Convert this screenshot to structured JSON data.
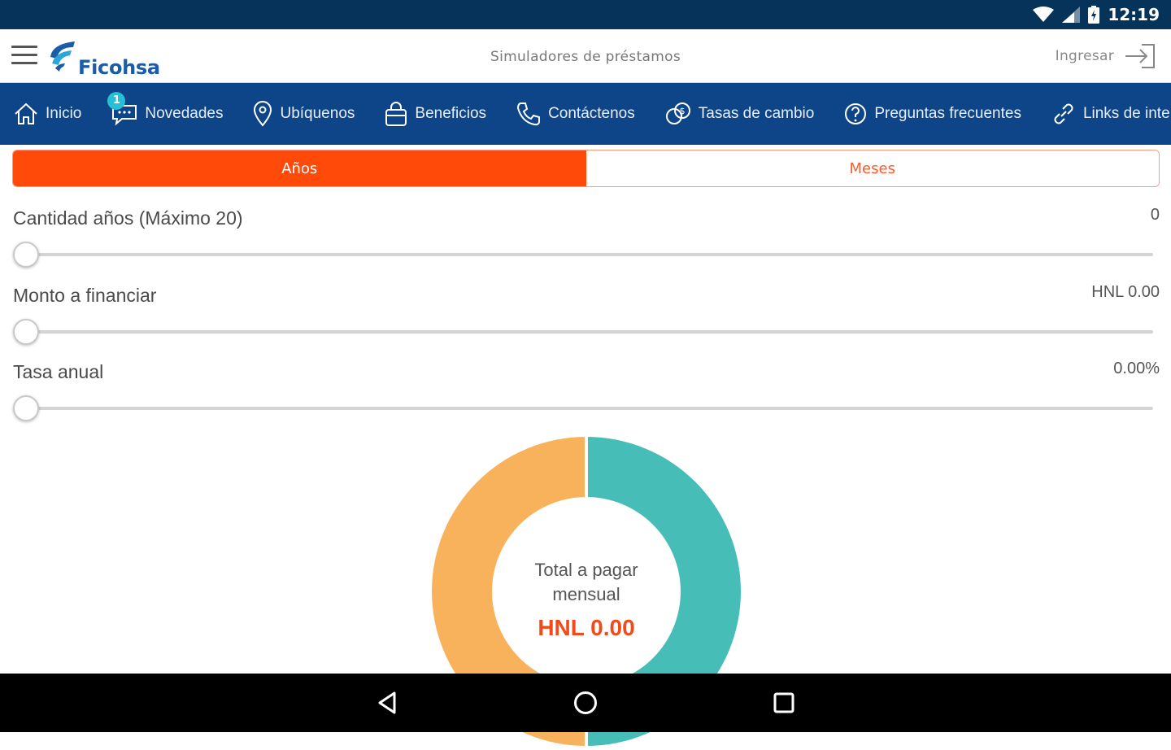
{
  "status_bar": {
    "time": "12:19"
  },
  "header": {
    "logo_text": "Ficohsa",
    "title": "Simuladores de préstamos",
    "login_label": "Ingresar"
  },
  "nav": {
    "items": [
      {
        "label": "Inicio",
        "icon": "home-icon"
      },
      {
        "label": "Novedades",
        "icon": "chat-icon",
        "badge": "1"
      },
      {
        "label": "Ubíquenos",
        "icon": "location-pin-icon"
      },
      {
        "label": "Beneficios",
        "icon": "bag-icon"
      },
      {
        "label": "Contáctenos",
        "icon": "phone-icon"
      },
      {
        "label": "Tasas de cambio",
        "icon": "exchange-icon"
      },
      {
        "label": "Preguntas frecuentes",
        "icon": "question-icon"
      },
      {
        "label": "Links de inte",
        "icon": "link-icon"
      }
    ]
  },
  "segment": {
    "years_label": "Años",
    "months_label": "Meses",
    "selected": "years"
  },
  "sliders": [
    {
      "label": "Cantidad años (Máximo 20)",
      "value": "0",
      "level": 0
    },
    {
      "label": "Monto a financiar",
      "value": "HNL 0.00",
      "level": 0
    },
    {
      "label": "Tasa anual",
      "value": "0.00%",
      "level": 0
    }
  ],
  "summary": {
    "title_line1": "Total a pagar",
    "title_line2": "mensual",
    "amount": "HNL 0.00"
  },
  "chart_data": {
    "type": "pie",
    "values": [
      50,
      50
    ],
    "colors": [
      "#47bdb8",
      "#f9b25c"
    ]
  },
  "colors": {
    "status_bar": "#06335a",
    "nav_bar": "#0d4588",
    "accent": "#ff4a0a",
    "donut_teal": "#47bdb8",
    "donut_orange": "#f9b25c"
  }
}
